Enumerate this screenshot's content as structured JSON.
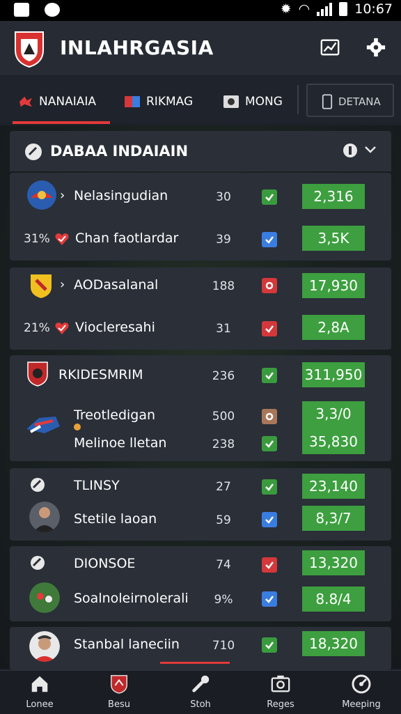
{
  "status_bar": {
    "time": "10:67"
  },
  "app": {
    "title": "INLAHRGASIA"
  },
  "tabs": [
    {
      "label": "NANAIAIA"
    },
    {
      "label": "RIKMAG"
    },
    {
      "label": "MONG"
    },
    {
      "label": "DETANA"
    }
  ],
  "section": {
    "title": "DABAA INDAIAIN"
  },
  "groups": [
    {
      "rows": [
        {
          "name": "Nelasingudian",
          "num": "30",
          "check": "green",
          "value": "2,316"
        },
        {
          "pct": "31%",
          "name": "Chan faotlardar",
          "num": "39",
          "check": "blue",
          "value": "3,5K"
        }
      ]
    },
    {
      "rows": [
        {
          "name": "AODasalanal",
          "num": "188",
          "check": "red-circle",
          "value": "17,930"
        },
        {
          "pct": "21%",
          "name": "Viocleresahi",
          "num": "31",
          "check": "red",
          "value": "2,8A"
        }
      ]
    },
    {
      "rows": [
        {
          "name": "RKIDESMRIM",
          "num": "236",
          "check": "green",
          "value": "311,950"
        },
        {
          "name": "Treotledigan",
          "num": "500",
          "check": "tan",
          "value": "3,3/0"
        },
        {
          "name": "Melinoe lletan",
          "num": "238",
          "check": "green",
          "value": "35,830"
        }
      ]
    },
    {
      "rows": [
        {
          "name": "TLINSY",
          "num": "27",
          "check": "green",
          "value": "23,140"
        },
        {
          "name": "Stetile laoan",
          "num": "59",
          "check": "blue",
          "value": "8,3/7"
        }
      ]
    },
    {
      "rows": [
        {
          "name": "DIONSOE",
          "num": "74",
          "check": "red",
          "value": "13,320"
        },
        {
          "name": "Soalnoleirnolerali",
          "num": "9%",
          "check": "blue",
          "value": "8.8/4"
        }
      ]
    },
    {
      "rows": [
        {
          "name": "Stanbal laneciin",
          "num": "710",
          "check": "green",
          "value": "18,320"
        }
      ]
    }
  ],
  "bottom_nav": [
    {
      "label": "Lonee",
      "icon": "home-icon"
    },
    {
      "label": "Besu",
      "icon": "shield-icon"
    },
    {
      "label": "Stoh",
      "icon": "wrench-icon"
    },
    {
      "label": "Reges",
      "icon": "camera-icon"
    },
    {
      "label": "Meeping",
      "icon": "gauge-icon"
    }
  ],
  "colors": {
    "accent": "#e23a3a",
    "value_green": "#3d9f3f",
    "card_bg": "#2a2f38",
    "app_bg": "#1d2129"
  }
}
